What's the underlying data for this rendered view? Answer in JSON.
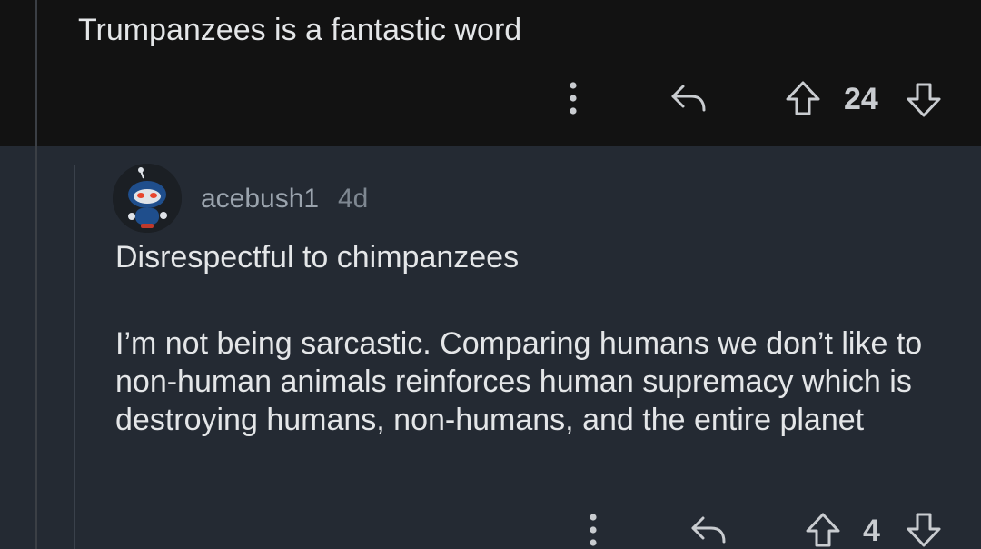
{
  "parent_comment": {
    "text": "Trumpanzees is a fantastic word",
    "score": "24",
    "icons": {
      "more": "more-vertical-icon",
      "reply": "reply-arrow-icon",
      "upvote": "upvote-arrow-icon",
      "downvote": "downvote-arrow-icon"
    }
  },
  "reply_comment": {
    "username": "acebush1",
    "age": "4d",
    "paragraphs": [
      "Disrespectful to chimpanzees",
      "I’m not being sarcastic. Comparing humans we don’t like to non-human animals reinforces human supremacy which is destroying humans, non-humans, and the entire planet"
    ],
    "score": "4"
  },
  "colors": {
    "parent_background": "#121212",
    "reply_background": "#242a33",
    "text": "#e4e6e8",
    "muted_text": "#9aa3ad",
    "avatar_accent": "#1f4e8c",
    "avatar_eyes": "#e8452c"
  }
}
